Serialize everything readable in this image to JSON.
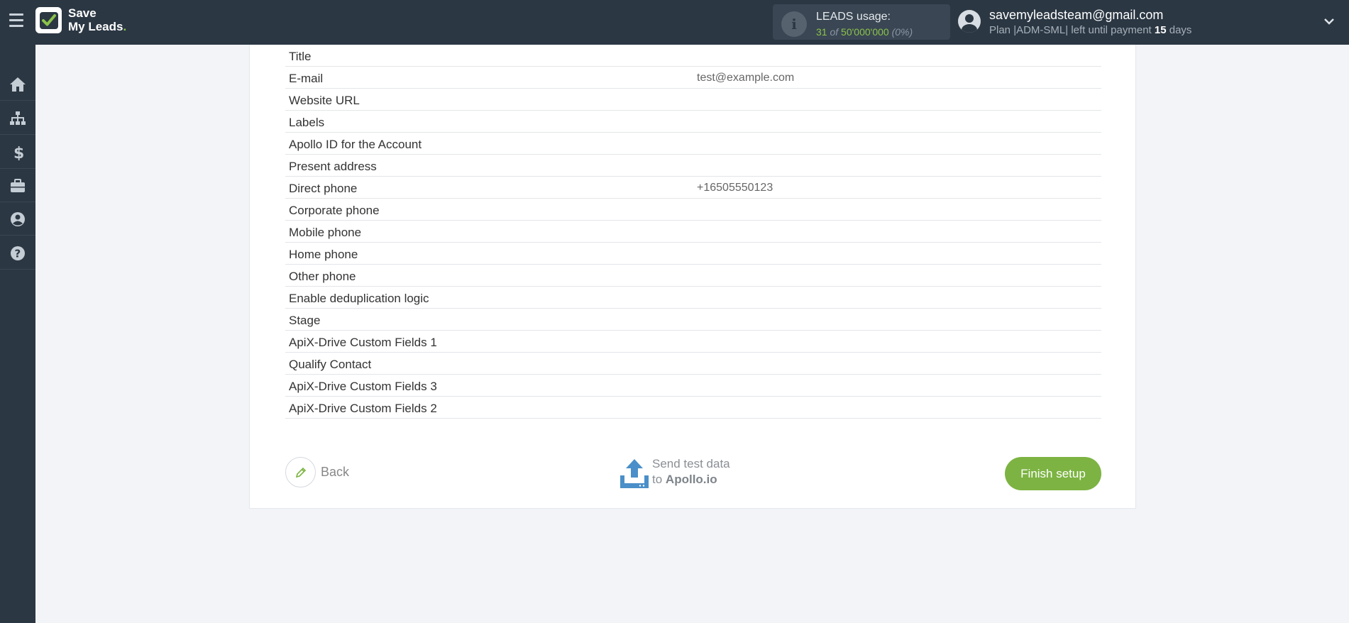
{
  "header": {
    "logo_line1": "Save",
    "logo_line2": "My Leads",
    "logo_dot": ".",
    "usage_label": "LEADS usage:",
    "usage_used": "31",
    "usage_of": "of",
    "usage_total": "50'000'000",
    "usage_percent": "(0%)",
    "account_email": "savemyleadsteam@gmail.com",
    "plan_prefix": "Plan |ADM-SML| left until payment",
    "plan_days": "15",
    "plan_suffix": "days"
  },
  "sidebar": {
    "items": [
      {
        "icon": "home-icon"
      },
      {
        "icon": "sitemap-icon"
      },
      {
        "icon": "dollar-icon"
      },
      {
        "icon": "briefcase-icon"
      },
      {
        "icon": "user-circle-icon"
      },
      {
        "icon": "help-icon"
      }
    ]
  },
  "fields": [
    {
      "label": "Title",
      "value": ""
    },
    {
      "label": "E-mail",
      "value": "test@example.com"
    },
    {
      "label": "Website URL",
      "value": ""
    },
    {
      "label": "Labels",
      "value": ""
    },
    {
      "label": "Apollo ID for the Account",
      "value": ""
    },
    {
      "label": "Present address",
      "value": ""
    },
    {
      "label": "Direct phone",
      "value": "+16505550123"
    },
    {
      "label": "Corporate phone",
      "value": ""
    },
    {
      "label": "Mobile phone",
      "value": ""
    },
    {
      "label": "Home phone",
      "value": ""
    },
    {
      "label": "Other phone",
      "value": ""
    },
    {
      "label": "Enable deduplication logic",
      "value": ""
    },
    {
      "label": "Stage",
      "value": ""
    },
    {
      "label": "ApiX-Drive Custom Fields 1",
      "value": ""
    },
    {
      "label": "Qualify Contact",
      "value": ""
    },
    {
      "label": "ApiX-Drive Custom Fields 3",
      "value": ""
    },
    {
      "label": "ApiX-Drive Custom Fields 2",
      "value": ""
    }
  ],
  "actions": {
    "back_label": "Back",
    "send_line1": "Send test data",
    "send_to": "to",
    "send_target": "Apollo.io",
    "finish_label": "Finish setup"
  },
  "colors": {
    "topbar": "#2b3743",
    "accent_green": "#7cb342",
    "upload_blue": "#4a8fc9"
  }
}
